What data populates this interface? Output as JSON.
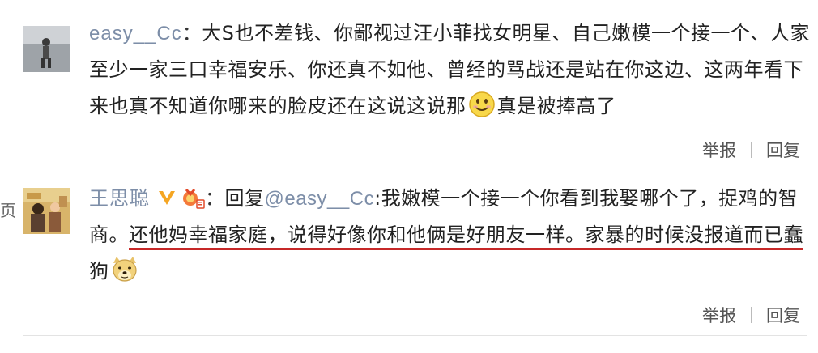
{
  "comments": [
    {
      "username": "easy__Cc",
      "separator": "：",
      "lines": [
        "大S也不差钱、你鄙视过汪小菲找女明星、自己嫩模一个接一个、人家",
        "至少一家三口幸福安乐、你还真不如他、曾经的骂战还是站在你这边、这两年看下",
        "来也真不知道你哪来的脸皮还在这说这说那"
      ],
      "emoji": "smiley-emoji",
      "tail": "真是被捧高了",
      "actions": {
        "report": "举报",
        "reply": "回复"
      }
    },
    {
      "username": "王思聪",
      "verified_icon": "verified-v-icon",
      "medal_icon": "medal-badge-icon",
      "separator": "：",
      "reply_prefix": "回复",
      "mention": "@easy__Cc",
      "colon": ":",
      "line1_text": "我嫩模一个接一个你看到我娶哪个了，捉鸡的智",
      "line2_prefix": "商。",
      "underlined_line2": "还他妈幸福家庭，说得好像你和他俩是好朋友一样。家暴的时候没报道而已蠢",
      "underlined_line3": "狗",
      "emoji": "doge-emoji",
      "actions": {
        "report": "举报",
        "reply": "回复"
      }
    }
  ],
  "edge_text": "页",
  "colors": {
    "username": "#7d8ea8",
    "underline": "#c62828",
    "text": "#222222",
    "verified": "#f5a623"
  }
}
